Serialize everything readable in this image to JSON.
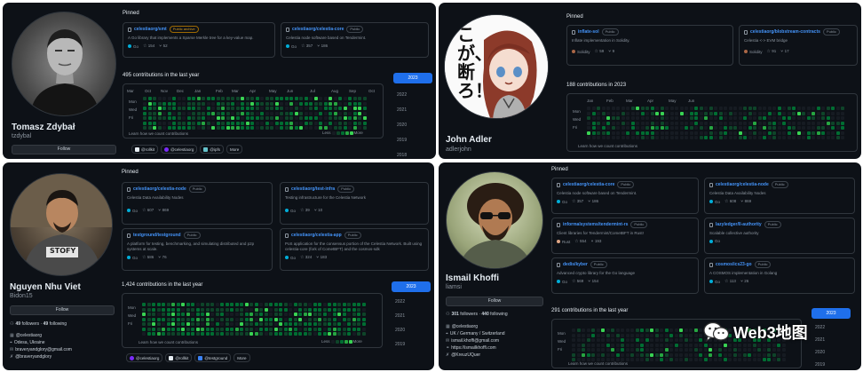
{
  "colors": {
    "bg": "#0d1117",
    "link": "#4493f8",
    "active_year": "#1f6feb",
    "go": "#00add8",
    "solidity": "#aa6746",
    "rust": "#dea584"
  },
  "profiles": [
    {
      "name": "Tomasz Zdybał",
      "username": "tzdybal",
      "follow_label": "Follow",
      "pinned_title": "Pinned",
      "repos": [
        {
          "name": "celestiaorg/smt",
          "badge": "Public archive",
          "desc": "A Go library that implements a Sparse Merkle tree for a key-value map.",
          "lang": "Go",
          "stars": "154",
          "forks": "52"
        },
        {
          "name": "celestiaorg/celestia-core",
          "badge": "Public",
          "desc": "Celestia node software based on Tendermint.",
          "lang": "Go",
          "stars": "357",
          "forks": "186"
        }
      ],
      "contrib_title": "495 contributions in the last year",
      "months": [
        "Mar",
        "Oct",
        "Nov",
        "Dec",
        "Jan",
        "Feb",
        "Mar",
        "Apr",
        "May",
        "Jun",
        "Jul",
        "Aug",
        "Sep",
        "Oct"
      ],
      "days": [
        "Mon",
        "Wed",
        "Fri"
      ],
      "learn": "Learn how we count contributions",
      "less": "Less",
      "more": "More",
      "years": [
        "2023",
        "2022",
        "2021",
        "2020",
        "2019",
        "2018"
      ],
      "orgs": [
        "@rollkit",
        "@celestiaorg",
        "@ipfs",
        "More"
      ]
    },
    {
      "name": "John Adler",
      "username": "adlerjohn",
      "avatar_text": "こが、断ろ！",
      "pinned_title": "Pinned",
      "repos": [
        {
          "name": "inflate-sol",
          "badge": "Public",
          "desc": "Inflate implementation in Solidity.",
          "lang": "Solidity",
          "stars": "59",
          "forks": "9"
        },
        {
          "name": "celestiaorg/blobstream-contracts",
          "badge": "Public",
          "desc": "Celestia <-> EVM bridge",
          "lang": "Solidity",
          "stars": "91",
          "forks": "17"
        }
      ],
      "contrib_title": "188 contributions in 2023",
      "months": [
        "Jan",
        "Feb",
        "Mar",
        "Apr",
        "May",
        "Jun"
      ],
      "days": [
        "Mon",
        "Wed",
        "Fri"
      ],
      "learn": "Learn how we count contributions"
    },
    {
      "name": "Nguyen Nhu Viet",
      "username": "Bidon15",
      "follow_label": "Follow",
      "followers": "49",
      "followers_label": "followers",
      "following": "49",
      "following_label": "following",
      "info": [
        "@celestiaorg",
        "Odesa, Ukraine",
        "braveryandglory@gmail.com",
        "@braveryandglory"
      ],
      "pinned_title": "Pinned",
      "repos": [
        {
          "name": "celestiaorg/celestia-node",
          "badge": "Public",
          "desc": "Celestia Data Availability Nodes",
          "lang": "Go",
          "stars": "607",
          "forks": "869"
        },
        {
          "name": "celestiaorg/test-infra",
          "badge": "Public",
          "desc": "Testing infrastructure for the Celestia Network",
          "lang": "Go",
          "stars": "39",
          "forks": "10"
        },
        {
          "name": "testground/testground",
          "badge": "Public",
          "desc": "A platform for testing, benchmarking, and simulating distributed and p2p systems at scale.",
          "lang": "Go",
          "stars": "586",
          "forks": "76"
        },
        {
          "name": "celestiaorg/celestia-app",
          "badge": "Public",
          "desc": "PoS application for the consensus portion of the Celestia Network. Built using celestia-core (fork of CometBFT) and the cosmos-sdk",
          "lang": "Go",
          "stars": "324",
          "forks": "183"
        }
      ],
      "contrib_title": "1,424 contributions in the last year",
      "days": [
        "Mon",
        "Wed",
        "Fri"
      ],
      "learn": "Learn how we count contributions",
      "less": "Less",
      "more": "More",
      "years": [
        "2023",
        "2022",
        "2021",
        "2020",
        "2019"
      ],
      "orgs": [
        "@celestiaorg",
        "@rollkit",
        "@testground",
        "More"
      ]
    },
    {
      "name": "Ismail Khoffi",
      "username": "liamsi",
      "follow_label": "Follow",
      "followers": "301",
      "followers_label": "followers",
      "following": "440",
      "following_label": "following",
      "info": [
        "@celestiaorg",
        "UK / Germany / Switzerland",
        "ismail.khoffi@gmail.com",
        "https://ismailkhoffi.com",
        "@KreuzUQuer"
      ],
      "pinned_title": "Pinned",
      "repos": [
        {
          "name": "celestiaorg/celestia-core",
          "badge": "Public",
          "desc": "Celestia node software based on Tendermint.",
          "lang": "Go",
          "stars": "357",
          "forks": "186"
        },
        {
          "name": "celestiaorg/celestia-node",
          "badge": "Public",
          "desc": "Celestia Data Availability Nodes",
          "lang": "Go",
          "stars": "608",
          "forks": "869"
        },
        {
          "name": "informalsystems/tendermint-rs",
          "badge": "Public",
          "desc": "Client libraries for Tendermint/CometBFT in Rust!",
          "lang": "Rust",
          "stars": "554",
          "forks": "193"
        },
        {
          "name": "lazyledger/ll-authority",
          "badge": "Public",
          "desc": "Scalable collective authority",
          "lang": "Go",
          "stars": "",
          "forks": ""
        },
        {
          "name": "dedis/kyber",
          "badge": "Public",
          "desc": "Advanced crypto library for the Go language",
          "lang": "Go",
          "stars": "569",
          "forks": "154"
        },
        {
          "name": "cosmos/ics23-go",
          "badge": "Public",
          "desc": "A COSMOS implementation in Golang",
          "lang": "Go",
          "stars": "113",
          "forks": "26"
        }
      ],
      "contrib_title": "291 contributions in the last year",
      "days": [
        "Mon",
        "Wed",
        "Fri"
      ],
      "learn": "Learn how we count contributions",
      "years": [
        "2023",
        "2022",
        "2021",
        "2020",
        "2019"
      ]
    }
  ],
  "watermark": {
    "text": "Web3地图"
  }
}
